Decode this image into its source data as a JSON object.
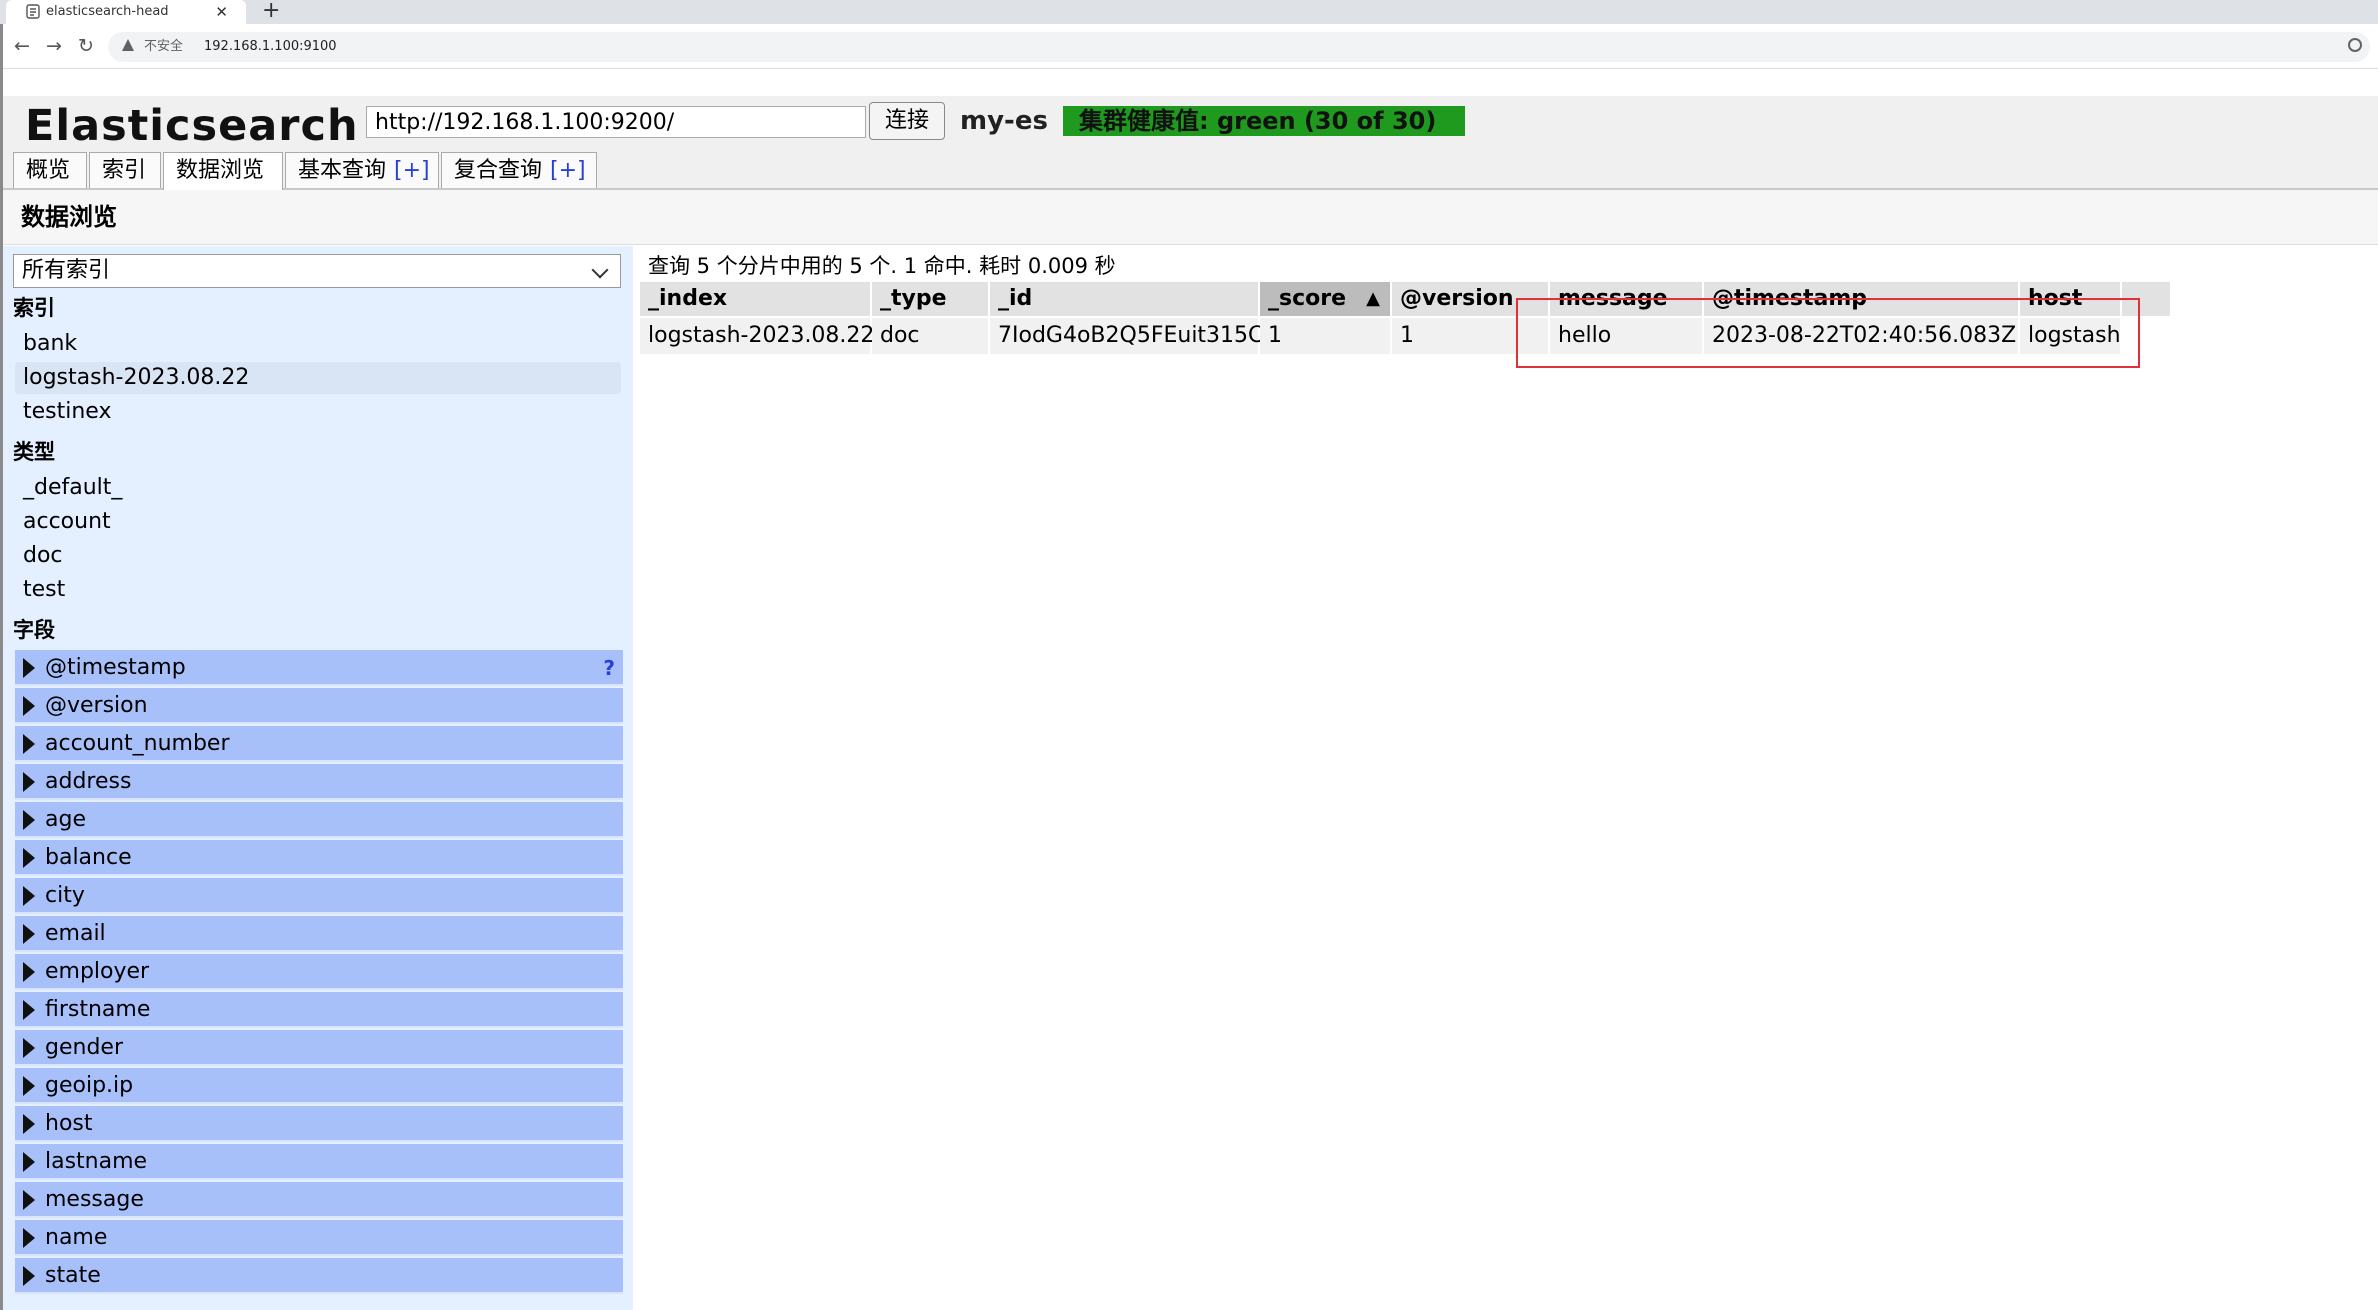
{
  "browser": {
    "tab_title": "elasticsearch-head",
    "tab_close": "✕",
    "new_tab": "+",
    "nav_back": "←",
    "nav_forward": "→",
    "nav_reload": "↻",
    "security_label": "不安全",
    "url": "192.168.1.100:9100"
  },
  "header": {
    "brand": "Elasticsearch",
    "connection_url": "http://192.168.1.100:9200/",
    "connect_label": "连接",
    "cluster_name": "my-es",
    "health_text": "集群健康值: green (30 of 30)",
    "health_color": "#1f9a1f"
  },
  "tabs": [
    {
      "label": "概览"
    },
    {
      "label": "索引"
    },
    {
      "label": "数据浏览"
    },
    {
      "label": "基本查询",
      "plus": "[+]"
    },
    {
      "label": "复合查询",
      "plus": "[+]"
    }
  ],
  "page_title": "数据浏览",
  "sidebar": {
    "index_select": "所有索引",
    "indices_heading": "索引",
    "indices": [
      "bank",
      "logstash-2023.08.22",
      "testinex"
    ],
    "types_heading": "类型",
    "types": [
      "_default_",
      "account",
      "doc",
      "test"
    ],
    "fields_heading": "字段",
    "fields_help": "?",
    "fields": [
      "@timestamp",
      "@version",
      "account_number",
      "address",
      "age",
      "balance",
      "city",
      "email",
      "employer",
      "firstname",
      "gender",
      "geoip.ip",
      "host",
      "lastname",
      "message",
      "name",
      "state"
    ]
  },
  "results": {
    "summary": "查询 5 个分片中用的 5 个. 1 命中. 耗时 0.009 秒",
    "sort_indicator": "▲",
    "columns": [
      "_index",
      "_type",
      "_id",
      "_score",
      "@version",
      "message",
      "@timestamp",
      "host"
    ],
    "rows": [
      [
        "logstash-2023.08.22",
        "doc",
        "7IodG4oB2Q5FEuit315C",
        "1",
        "1",
        "hello",
        "2023-08-22T02:40:56.083Z",
        "logstash"
      ]
    ]
  },
  "colors": {
    "annotation_box": "#e0303a",
    "sidebar_bg": "#e4efff",
    "field_row": "#a8c0fa"
  }
}
